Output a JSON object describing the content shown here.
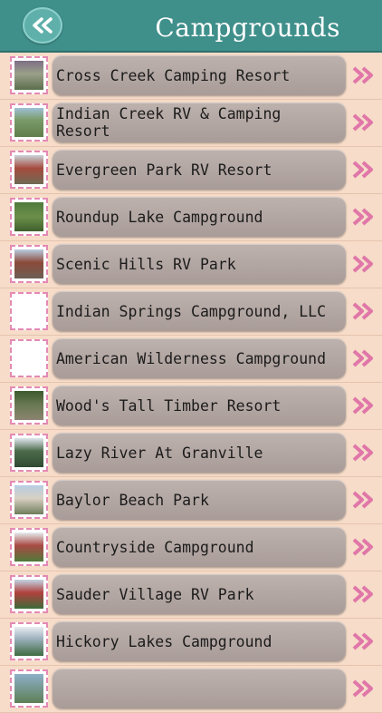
{
  "header": {
    "title": "Campgrounds",
    "back_icon": "double-chevron-left-icon",
    "bar_color": "#3f8f8b"
  },
  "items": [
    {
      "label": "Cross Creek Camping Resort",
      "thumb": "photo"
    },
    {
      "label": "Indian Creek RV & Camping Resort",
      "thumb": "photo"
    },
    {
      "label": "Evergreen Park RV Resort",
      "thumb": "photo"
    },
    {
      "label": "Roundup Lake Campground",
      "thumb": "photo"
    },
    {
      "label": "Scenic Hills RV Park",
      "thumb": "photo"
    },
    {
      "label": "Indian Springs Campground, LLC",
      "thumb": "blank"
    },
    {
      "label": "American Wilderness Campground",
      "thumb": "blank"
    },
    {
      "label": "Wood's Tall Timber Resort",
      "thumb": "photo"
    },
    {
      "label": "Lazy River At Granville",
      "thumb": "photo"
    },
    {
      "label": "Baylor Beach Park",
      "thumb": "photo"
    },
    {
      "label": "Countryside Campground",
      "thumb": "photo"
    },
    {
      "label": "Sauder Village RV Park",
      "thumb": "photo"
    },
    {
      "label": "Hickory Lakes Campground",
      "thumb": "photo"
    },
    {
      "label": "",
      "thumb": "photo"
    }
  ],
  "row_arrow_icon": "double-chevron-right-icon",
  "colors": {
    "background": "#f6dcc9",
    "pill": "#b3a7a3",
    "chevron": "#e077a8",
    "thumb_border": "#e48ab4"
  }
}
